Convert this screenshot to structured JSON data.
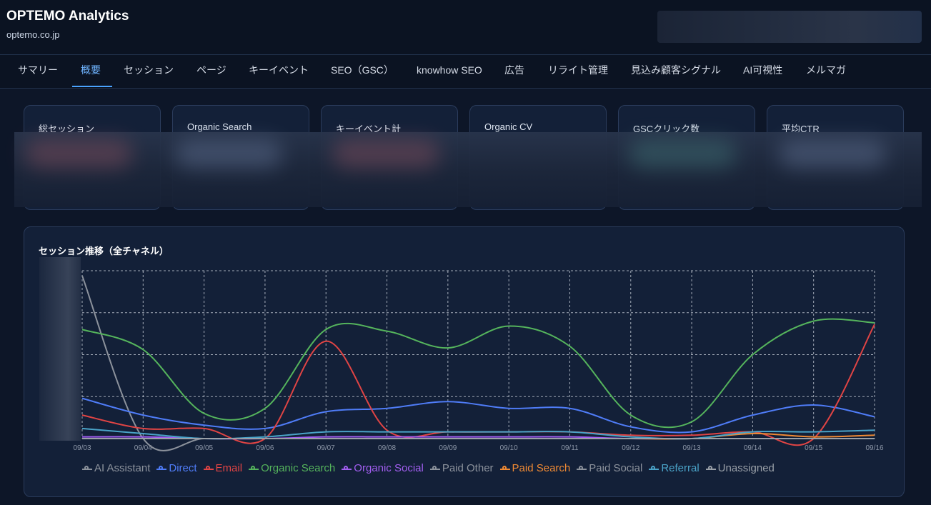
{
  "header": {
    "title": "OPTEMO Analytics",
    "domain": "optemo.co.jp"
  },
  "tabs": [
    {
      "label": "サマリー"
    },
    {
      "label": "概要",
      "active": true
    },
    {
      "label": "セッション"
    },
    {
      "label": "ページ"
    },
    {
      "label": "キーイベント"
    },
    {
      "label": "SEO（GSC）"
    },
    {
      "label": "knowhow SEO"
    },
    {
      "label": "広告"
    },
    {
      "label": "リライト管理"
    },
    {
      "label": "見込み顧客シグナル"
    },
    {
      "label": "AI可視性"
    },
    {
      "label": "メルマガ"
    }
  ],
  "kpis": [
    {
      "label": "総セッション"
    },
    {
      "label": "Organic Search"
    },
    {
      "label": "キーイベント計"
    },
    {
      "label": "Organic CV"
    },
    {
      "label": "GSCクリック数"
    },
    {
      "label": "平均CTR"
    }
  ],
  "chart_title": "セッション推移（全チャネル）",
  "colors": {
    "accent": "#4aa3ff",
    "background": "#0d1628",
    "panel": "#132038"
  },
  "chart_data": {
    "type": "line",
    "title": "セッション推移（全チャネル）",
    "categories": [
      "09/03",
      "09/04",
      "09/05",
      "09/06",
      "09/07",
      "09/08",
      "09/09",
      "09/10",
      "09/11",
      "09/12",
      "09/13",
      "09/14",
      "09/15",
      "09/16"
    ],
    "ylim": [
      0,
      100
    ],
    "y_unit_note": "y-axis tick labels are obscured; values are relative (0–100 of visible plot height)",
    "grid": true,
    "legend_position": "bottom",
    "series": [
      {
        "name": "AI Assistant",
        "color": "#8c929c",
        "values": [
          97,
          0,
          0,
          0,
          0,
          0,
          0,
          0,
          0,
          0,
          0,
          0,
          0,
          0
        ]
      },
      {
        "name": "Direct",
        "color": "#4f7cf7",
        "values": [
          24,
          14,
          8,
          6,
          16,
          18,
          22,
          18,
          18,
          7,
          4,
          14,
          20,
          13
        ]
      },
      {
        "name": "Email",
        "color": "#e04444",
        "values": [
          14,
          6,
          6,
          0,
          58,
          5,
          4,
          4,
          4,
          2,
          2,
          4,
          0,
          68
        ]
      },
      {
        "name": "Organic Search",
        "color": "#55b45c",
        "values": [
          65,
          53,
          15,
          18,
          65,
          64,
          54,
          67,
          55,
          14,
          10,
          50,
          70,
          69
        ]
      },
      {
        "name": "Organic Social",
        "color": "#a25ef0",
        "values": [
          1,
          1,
          0,
          0,
          1,
          1,
          1,
          1,
          1,
          0,
          0,
          0,
          0,
          0
        ]
      },
      {
        "name": "Paid Other",
        "color": "#8c929c",
        "values": [
          0,
          0,
          0,
          0,
          0,
          0,
          0,
          0,
          0,
          0,
          0,
          0,
          0,
          0
        ]
      },
      {
        "name": "Paid Search",
        "color": "#f08a34",
        "values": [
          0,
          0,
          0,
          0,
          0,
          0,
          0,
          0,
          0,
          0,
          0,
          3,
          1,
          2
        ]
      },
      {
        "name": "Paid Social",
        "color": "#8c929c",
        "values": [
          0,
          0,
          0,
          0,
          0,
          0,
          0,
          0,
          0,
          0,
          0,
          0,
          0,
          0
        ]
      },
      {
        "name": "Referral",
        "color": "#4aa3c8",
        "values": [
          6,
          3,
          0,
          1,
          4,
          4,
          4,
          4,
          4,
          1,
          0,
          4,
          4,
          5
        ]
      },
      {
        "name": "Unassigned",
        "color": "#9aa0a8",
        "values": [
          0,
          0,
          0,
          0,
          0,
          0,
          0,
          0,
          0,
          0,
          0,
          0,
          0,
          0
        ]
      }
    ]
  }
}
